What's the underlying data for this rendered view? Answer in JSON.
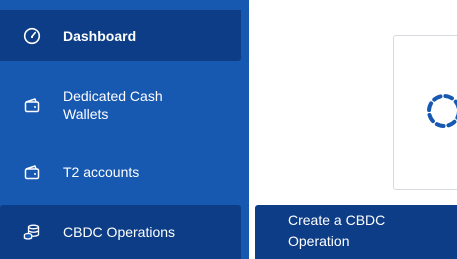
{
  "sidebar": {
    "items": [
      {
        "label": "Dashboard",
        "icon": "dashboard-gauge-icon",
        "active": true
      },
      {
        "label": "Dedicated Cash\nWallets",
        "icon": "wallet-icon"
      },
      {
        "label": "T2 accounts",
        "icon": "wallet-icon"
      },
      {
        "label": "CBDC Operations",
        "icon": "coins-stack-icon",
        "expanded": true
      }
    ]
  },
  "submenu": {
    "items": [
      {
        "label": "Create a CBDC\nOperation"
      }
    ]
  },
  "colors": {
    "sidebar_bg": "#1758b0",
    "active_bg": "#0d3d86",
    "spinner": "#1758b0"
  }
}
